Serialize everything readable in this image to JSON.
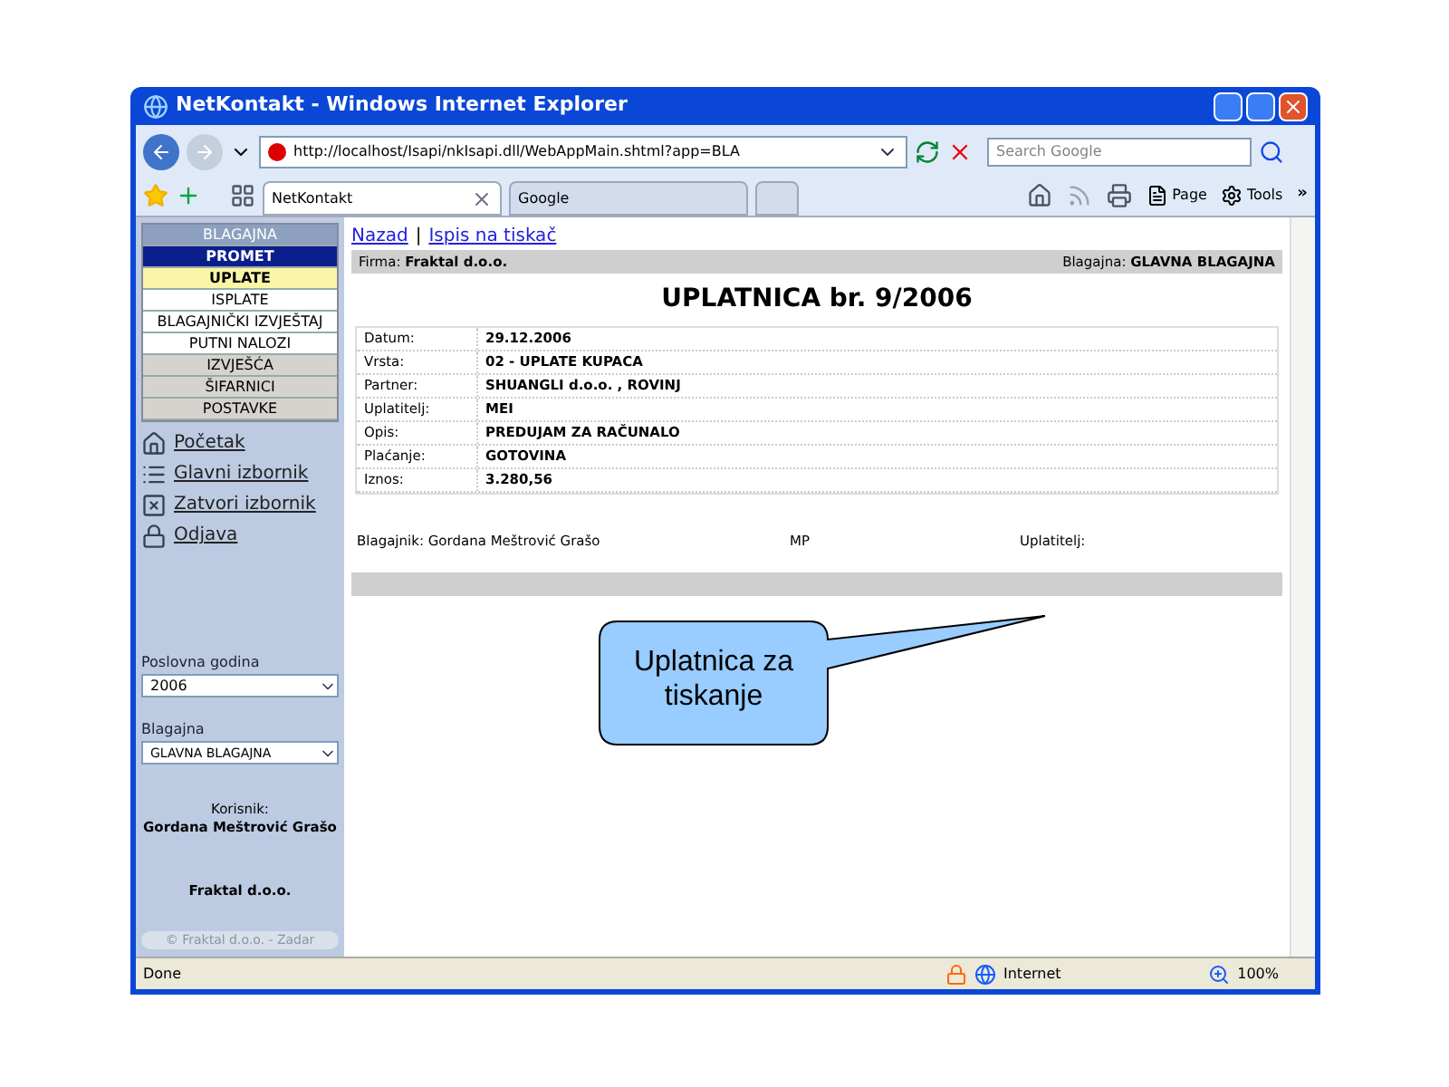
{
  "window": {
    "title": "NetKontakt - Windows Internet Explorer"
  },
  "address_bar": {
    "url": "http://localhost/Isapi/nkIsapi.dll/WebAppMain.shtml?app=BLA"
  },
  "search": {
    "placeholder": "Search Google"
  },
  "tabs": [
    {
      "label": "NetKontakt",
      "selected": true
    },
    {
      "label": "Google",
      "selected": false
    }
  ],
  "command_bar": {
    "page": "Page",
    "tools": "Tools",
    "more": "»"
  },
  "sidebar": {
    "menu": [
      {
        "label": "BLAGAJNA",
        "kind": "header"
      },
      {
        "label": "PROMET",
        "kind": "section",
        "selected": true
      },
      {
        "label": "UPLATE",
        "kind": "item",
        "selected": true
      },
      {
        "label": "ISPLATE",
        "kind": "item",
        "selected": false
      },
      {
        "label": "BLAGAJNIČKI IZVJEŠTAJ",
        "kind": "item",
        "selected": false
      },
      {
        "label": "PUTNI NALOZI",
        "kind": "item",
        "selected": false
      },
      {
        "label": "IZVJEŠĆA",
        "kind": "section",
        "selected": false
      },
      {
        "label": "ŠIFARNICI",
        "kind": "section",
        "selected": false
      },
      {
        "label": "POSTAVKE",
        "kind": "section",
        "selected": false
      }
    ],
    "links": [
      {
        "label": "Početak",
        "kind": "home"
      },
      {
        "label": "Glavni izbornik",
        "kind": "menu"
      },
      {
        "label": "Zatvori izbornik",
        "kind": "close"
      },
      {
        "label": "Odjava",
        "kind": "lock"
      }
    ],
    "year_label": "Poslovna godina",
    "year_value": "2006",
    "cashbox_label": "Blagajna",
    "cashbox_value": "GLAVNA BLAGAJNA",
    "user_label": "Korisnik:",
    "user_name": "Gordana Meštrović Grašo",
    "company": "Fraktal d.o.o.",
    "footer": "© Fraktal d.o.o. - Zadar"
  },
  "page": {
    "nav_back": "Nazad",
    "separator": "|",
    "nav_print": "Ispis na tiskač",
    "firm_label": "Firma:",
    "firm_value": "Fraktal d.o.o.",
    "cashbox_label": "Blagajna:",
    "cashbox_value": "GLAVNA BLAGAJNA",
    "heading": "UPLATNICA br. 9/2006",
    "fields": [
      {
        "label": "Datum:",
        "value": "29.12.2006"
      },
      {
        "label": "Vrsta:",
        "value": "02 - UPLATE KUPACA"
      },
      {
        "label": "Partner:",
        "value": "SHUANGLI d.o.o. , ROVINJ"
      },
      {
        "label": "Uplatitelj:",
        "value": "MEI"
      },
      {
        "label": "Opis:",
        "value": "PREDUJAM ZA RAČUNALO"
      },
      {
        "label": "Plaćanje:",
        "value": "GOTOVINA"
      },
      {
        "label": "Iznos:",
        "value": "3.280,56"
      }
    ],
    "signatures": {
      "cashier_label": "Blagajnik:",
      "cashier_name": "Gordana Meštrović Grašo",
      "stamp": "MP",
      "payer_label": "Uplatitelj:"
    }
  },
  "callout": {
    "text": "Uplatnica za tiskanje"
  },
  "status_bar": {
    "status": "Done",
    "zone": "Internet",
    "zoom": "100%"
  }
}
